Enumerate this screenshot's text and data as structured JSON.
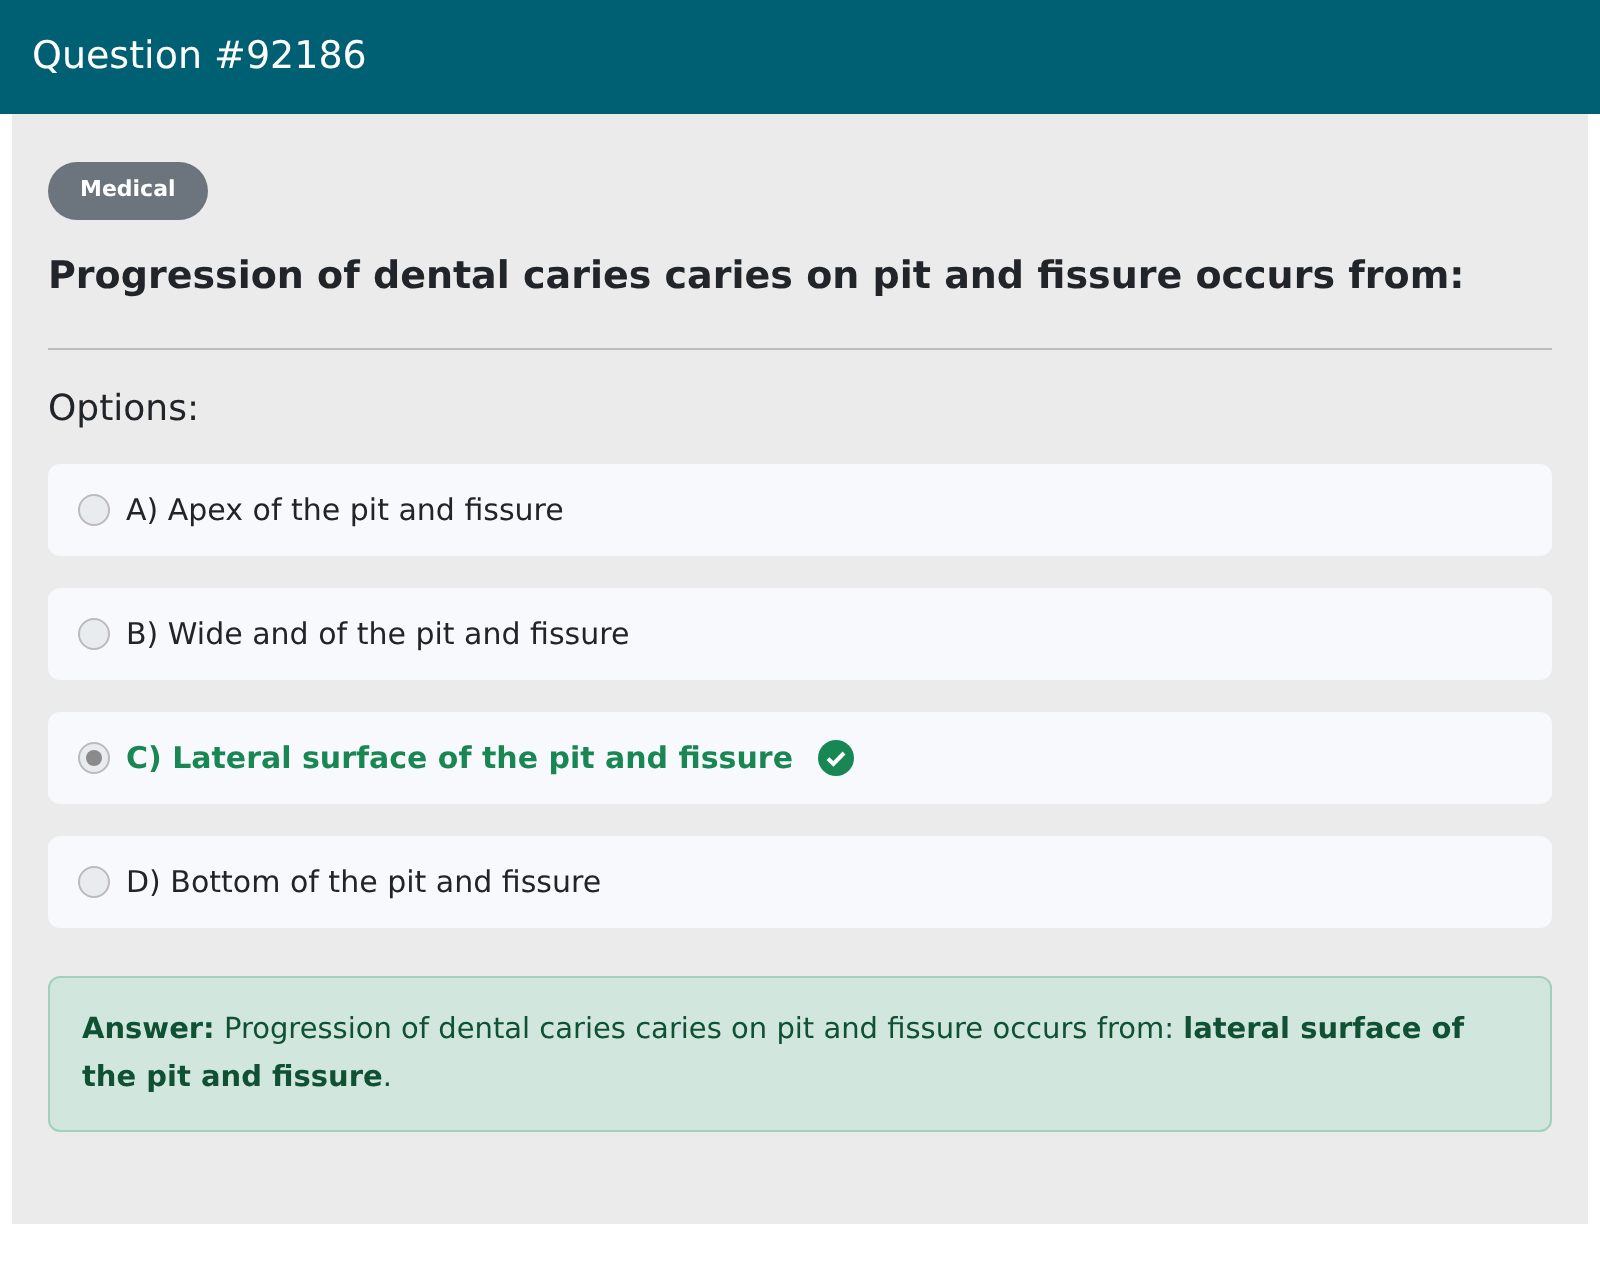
{
  "header": {
    "title": "Question #92186"
  },
  "category": "Medical",
  "question": "Progression of dental caries caries on pit and fissure occurs from:",
  "options_label": "Options:",
  "options": [
    {
      "label": "A) Apex of the pit and fissure",
      "selected": false,
      "correct": false
    },
    {
      "label": "B) Wide and of the pit and fissure",
      "selected": false,
      "correct": false
    },
    {
      "label": "C) Lateral surface of the pit and fissure",
      "selected": true,
      "correct": true
    },
    {
      "label": "D) Bottom of the pit and fissure",
      "selected": false,
      "correct": false
    }
  ],
  "answer": "**Answer:** Progression of dental caries caries on pit and fissure occurs from: **lateral surface of the pit and fissure**."
}
